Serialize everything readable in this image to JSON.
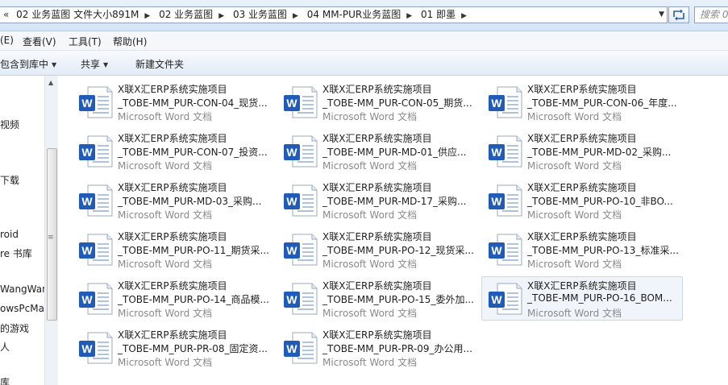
{
  "address_bar": {
    "prefix": "«",
    "crumbs": [
      "02 业务蓝图 文件大小891M",
      "02 业务蓝图",
      "03 业务蓝图",
      "04 MM-PUR业务蓝图",
      "01 即墨"
    ],
    "refresh_icon": "refresh-icon",
    "search_placeholder": "搜索 0"
  },
  "menu": {
    "items": [
      "(E)",
      "查看(V)",
      "工具(T)",
      "帮助(H)"
    ]
  },
  "toolbar": {
    "include_library": "包含到库中",
    "share": "共享",
    "new_folder": "新建文件夹"
  },
  "nav": {
    "items": [
      "视频",
      "下载",
      "roid",
      "re 书库",
      "WangWan",
      "owsPcMa",
      "的游戏",
      "人",
      "库"
    ]
  },
  "files": [
    {
      "line1": "X联X汇ERP系统实施项目",
      "line2": "_TOBE-MM_PUR-CON-04_现货...",
      "type": "Microsoft Word 文档"
    },
    {
      "line1": "X联X汇ERP系统实施项目",
      "line2": "_TOBE-MM_PUR-CON-05_期货...",
      "type": "Microsoft Word 文档"
    },
    {
      "line1": "X联X汇ERP系统实施项目",
      "line2": "_TOBE-MM_PUR-CON-06_年度...",
      "type": "Microsoft Word 文档"
    },
    {
      "line1": "X联X汇ERP系统实施项目",
      "line2": "_TOBE-MM_PUR-CON-07_投资...",
      "type": "Microsoft Word 文档"
    },
    {
      "line1": "X联X汇ERP系统实施项目",
      "line2": "_TOBE-MM_PUR-MD-01_供应...",
      "type": "Microsoft Word 文档"
    },
    {
      "line1": "X联X汇ERP系统实施项目",
      "line2": "_TOBE-MM_PUR-MD-02_采购...",
      "type": "Microsoft Word 文档"
    },
    {
      "line1": "X联X汇ERP系统实施项目",
      "line2": "_TOBE-MM_PUR-MD-03_采购...",
      "type": "Microsoft Word 文档"
    },
    {
      "line1": "X联X汇ERP系统实施项目",
      "line2": "_TOBE-MM_PUR-MD-17_采购...",
      "type": "Microsoft Word 文档"
    },
    {
      "line1": "X联X汇ERP系统实施项目",
      "line2": "_TOBE-MM_PUR-PO-10_非BO...",
      "type": "Microsoft Word 文档"
    },
    {
      "line1": "X联X汇ERP系统实施项目",
      "line2": "_TOBE-MM_PUR-PO-11_期货采...",
      "type": "Microsoft Word 文档"
    },
    {
      "line1": "X联X汇ERP系统实施项目",
      "line2": "_TOBE-MM_PUR-PO-12_现货采...",
      "type": "Microsoft Word 文档"
    },
    {
      "line1": "X联X汇ERP系统实施项目",
      "line2": "_TOBE-MM_PUR-PO-13_标准采...",
      "type": "Microsoft Word 文档"
    },
    {
      "line1": "X联X汇ERP系统实施项目",
      "line2": "_TOBE-MM_PUR-PO-14_商品模...",
      "type": "Microsoft Word 文档"
    },
    {
      "line1": "X联X汇ERP系统实施项目",
      "line2": "_TOBE-MM_PUR-PO-15_委外加...",
      "type": "Microsoft Word 文档"
    },
    {
      "line1": "X联X汇ERP系统实施项目",
      "line2": "_TOBE-MM_PUR-PO-16_BOM...",
      "type": "Microsoft Word 文档",
      "selected": true
    },
    {
      "line1": "X联X汇ERP系统实施项目",
      "line2": "_TOBE-MM_PUR-PR-08_固定资...",
      "type": "Microsoft Word 文档"
    },
    {
      "line1": "X联X汇ERP系统实施项目",
      "line2": "_TOBE-MM_PUR-PR-09_办公用...",
      "type": "Microsoft Word 文档"
    }
  ],
  "colors": {
    "word_blue": "#1f5bb7",
    "type_gray": "#8a8a8a",
    "selection": "#f0f5fc"
  }
}
